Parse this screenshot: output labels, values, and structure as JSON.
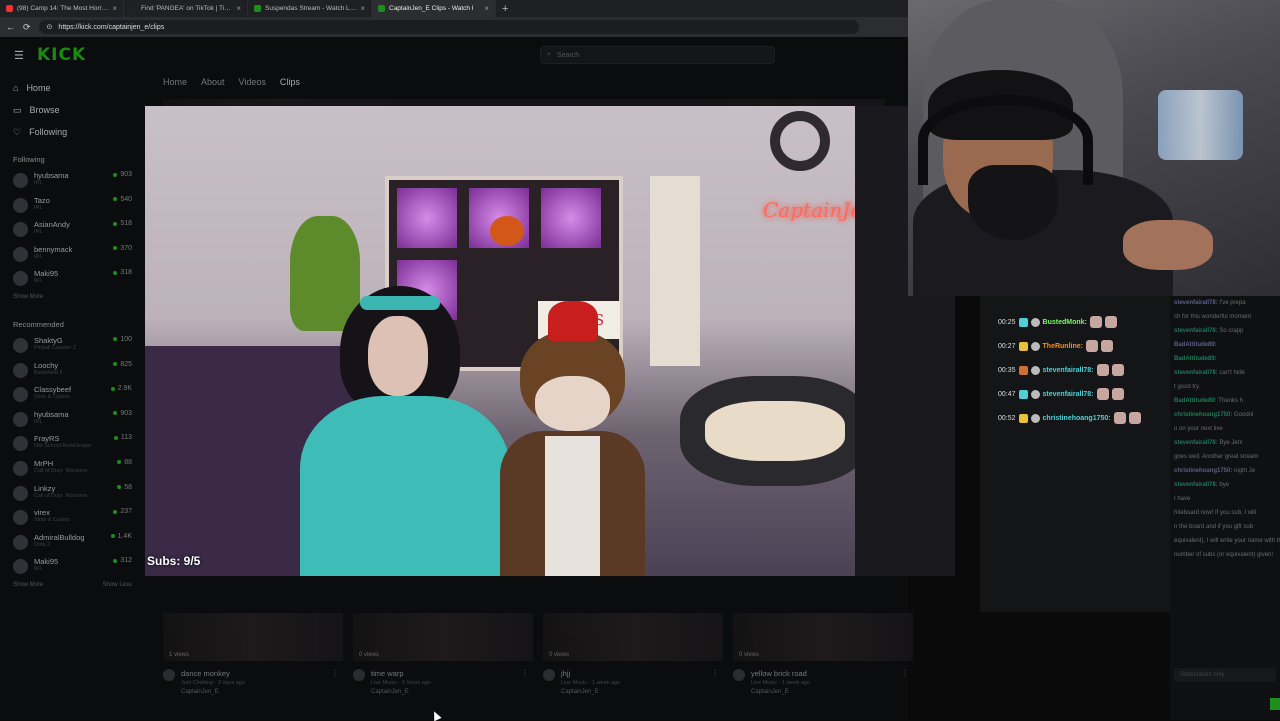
{
  "browser": {
    "tabs": [
      {
        "label": "(98) Camp 14: The Most Horrible",
        "fav": "#e33"
      },
      {
        "label": "Find 'PANGEA' on TikTok | TikTok",
        "fav": "#222"
      },
      {
        "label": "Suspendas Stream - Watch Live o",
        "fav": "#1c8e1c"
      },
      {
        "label": "CaptainJen_E Clips - Watch l",
        "fav": "#1c8e1c"
      }
    ],
    "url": "https://kick.com/captainjen_e/clips"
  },
  "kick": {
    "logo": "KICK",
    "search_placeholder": "Search",
    "nav": {
      "home": "Home",
      "browse": "Browse",
      "following": "Following"
    },
    "following_header": "Following",
    "following": [
      {
        "name": "hyubsama",
        "cat": "IRL",
        "count": "903"
      },
      {
        "name": "Tazo",
        "cat": "IRL",
        "count": "540"
      },
      {
        "name": "AsianAndy",
        "cat": "IRL",
        "count": "518"
      },
      {
        "name": "bennymack",
        "cat": "IRL",
        "count": "370"
      },
      {
        "name": "Maki95",
        "cat": "IRL",
        "count": "318"
      }
    ],
    "show_more_1": "Show More",
    "recommended_header": "Recommended",
    "recommended": [
      {
        "name": "ShaktyG",
        "cat": "Pinball Coaster 2",
        "count": "100"
      },
      {
        "name": "Loochy",
        "cat": "Battlefield 6",
        "count": "825"
      },
      {
        "name": "Classybeef",
        "cat": "Slots & Casino",
        "count": "2.9K"
      },
      {
        "name": "hyubsama",
        "cat": "IRL",
        "count": "903"
      },
      {
        "name": "FrayRS",
        "cat": "Old School RuneScape",
        "count": "113"
      },
      {
        "name": "MrPH",
        "cat": "Call of Duty: Warzone",
        "count": "88"
      },
      {
        "name": "Linkzy",
        "cat": "Call of Duty: Warzone",
        "count": "58"
      },
      {
        "name": "virex",
        "cat": "Slots & Casino",
        "count": "237"
      },
      {
        "name": "AdmiralBulldog",
        "cat": "Dota 2",
        "count": "1.4K"
      },
      {
        "name": "Maki95",
        "cat": "IRL",
        "count": "312"
      }
    ],
    "show_more_2": "Show More",
    "show_less": "Show Less",
    "channel_tabs": [
      "Home",
      "About",
      "Videos",
      "Clips"
    ],
    "clips": [
      {
        "views": "1 views",
        "title": "dance monkey",
        "sub": "Just Chatting · 2 days ago",
        "owner": "CaptainJen_E"
      },
      {
        "views": "0 views",
        "title": "time warp",
        "sub": "Live Music · 9 hours ago",
        "owner": "CaptainJen_E"
      },
      {
        "views": "0 views",
        "title": "jhjj",
        "sub": "Live Music · 1 week ago",
        "owner": "CaptainJen_E"
      },
      {
        "views": "0 views",
        "title": "yellow brick road",
        "sub": "Live Music · 1 week ago",
        "owner": "CaptainJen_E"
      }
    ]
  },
  "player": {
    "subs_sign": "SUBS",
    "subs_counter": "Subs: 9/5"
  },
  "overlay_chat": [
    {
      "time": "00:25",
      "user": "BustedMonk:",
      "color": "#7cf56a"
    },
    {
      "time": "00:27",
      "user": "TheRunline:",
      "color": "#ff8a1f"
    },
    {
      "time": "00:35",
      "user": "stevenfairall78:",
      "color": "#4fd0d8"
    },
    {
      "time": "00:47",
      "user": "stevenfairall78:",
      "color": "#4fd0d8"
    },
    {
      "time": "00:52",
      "user": "christinehoang1750:",
      "color": "#4fd0d8"
    }
  ],
  "kick_chat": [
    {
      "user": "stevenfairall78:",
      "msg": "I've prepa"
    },
    {
      "user": "",
      "msg": "ch for this wonderful moment"
    },
    {
      "user": "stevenfairall78:",
      "msg": "So crapp"
    },
    {
      "user": "BadAttitude89:",
      "msg": ""
    },
    {
      "user": "BadAttitude89:",
      "msg": ""
    },
    {
      "user": "stevenfairall78:",
      "msg": "can't hide"
    },
    {
      "user": "",
      "msg": "t good try."
    },
    {
      "user": "BadAttitude89:",
      "msg": "Thanks h"
    },
    {
      "user": "christinehoang1750:",
      "msg": "Goodni"
    },
    {
      "user": "",
      "msg": "u on your next live"
    },
    {
      "user": "stevenfairall78:",
      "msg": "Bye Jen!"
    },
    {
      "user": "",
      "msg": "goes well. Another great stream"
    },
    {
      "user": "christinehoang1750:",
      "msg": "night Je"
    },
    {
      "user": "stevenfairall78:",
      "msg": "bye"
    },
    {
      "user": "",
      "msg": "I have"
    },
    {
      "user": "",
      "msg": "hiteboard now! If you sub, I will"
    },
    {
      "user": "",
      "msg": "n the board and if you gift sub"
    },
    {
      "user": "",
      "msg": "equivalent), I will write your name with the"
    },
    {
      "user": "",
      "msg": "number of subs (or equivalent) given!"
    }
  ],
  "chat_input_placeholder": "Subscribers only"
}
